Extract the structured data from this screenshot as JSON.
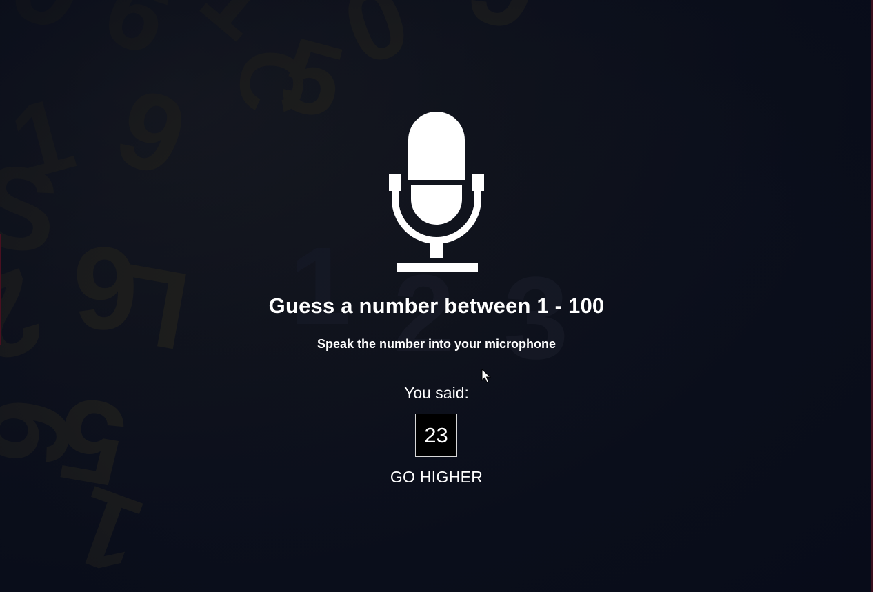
{
  "game": {
    "title": "Guess a number between 1 - 100",
    "subtitle": "Speak the number into your microphone",
    "you_said_label": "You said:",
    "guess_value": "23",
    "hint": "GO HIGHER"
  },
  "icons": {
    "mic": "microphone-icon",
    "cursor": "mouse-pointer-icon"
  },
  "colors": {
    "background": "#0b0f1c",
    "text": "#ffffff",
    "guess_box_bg": "#000000",
    "guess_box_border": "#d8d8d8",
    "bg_digits": "#23221d"
  }
}
